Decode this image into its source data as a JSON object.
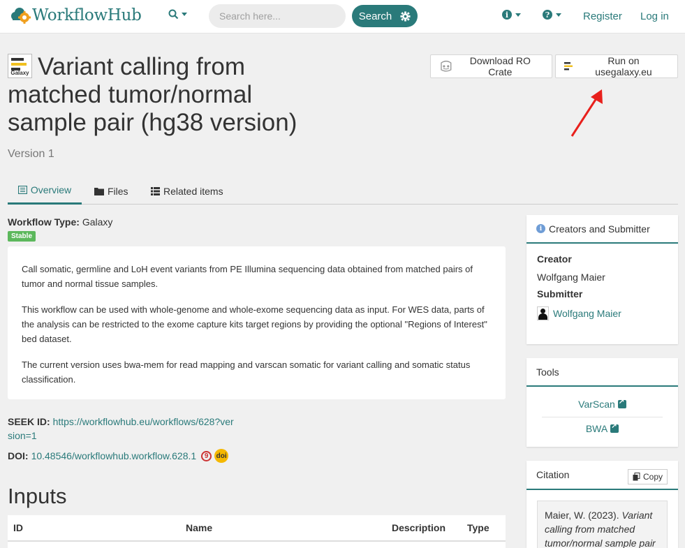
{
  "brand": {
    "name": "WorkflowHub",
    "accent": "#2a7a7a"
  },
  "navbar": {
    "search_placeholder": "Search here...",
    "search_button": "Search",
    "register": "Register",
    "login": "Log in"
  },
  "page": {
    "title": "Variant calling from matched tumor/normal sample pair (hg38 version)",
    "version": "Version 1",
    "icon_label": "Galaxy",
    "download_ro_crate": "Download RO Crate",
    "run_on_galaxy": "Run on usegalaxy.eu"
  },
  "tabs": [
    {
      "label": "Overview",
      "active": true
    },
    {
      "label": "Files"
    },
    {
      "label": "Related items"
    }
  ],
  "overview": {
    "workflow_type_label": "Workflow Type:",
    "workflow_type_value": "Galaxy",
    "status_badge": "Stable",
    "description": [
      "Call somatic, germline and LoH event variants from PE Illumina sequencing data obtained from matched pairs of tumor and normal tissue samples.",
      "This workflow can be used with whole-genome and whole-exome sequencing data as input. For WES data, parts of the analysis can be restricted to the exome capture kits target regions by providing the optional \"Regions of Interest\" bed dataset.",
      "The current version uses bwa-mem for read mapping and varscan somatic for variant calling and somatic status classification."
    ],
    "seek_id_label": "SEEK ID:",
    "seek_id_value": "https://workflowhub.eu/workflows/628?version=1",
    "doi_label": "DOI:",
    "doi_value": "10.48546/workflowhub.workflow.628.1",
    "doi_badge": "doi"
  },
  "inputs": {
    "heading": "Inputs",
    "columns": [
      "ID",
      "Name",
      "Description",
      "Type"
    ]
  },
  "sidebar": {
    "creators": {
      "title": "Creators and Submitter",
      "creator_label": "Creator",
      "creator_name": "Wolfgang Maier",
      "submitter_label": "Submitter",
      "submitter_name": "Wolfgang Maier"
    },
    "tools": {
      "title": "Tools",
      "items": [
        "VarScan",
        "BWA"
      ]
    },
    "citation": {
      "title": "Citation",
      "copy_label": "Copy",
      "text_plain": "Maier, W. (2023). ",
      "text_italic": "Variant calling from matched tumor/normal sample pair"
    }
  },
  "icons": {
    "search": "search-icon",
    "gear": "gear-icon",
    "info": "info-icon",
    "help": "help-icon",
    "arrow": "red-arrow-annotation"
  }
}
